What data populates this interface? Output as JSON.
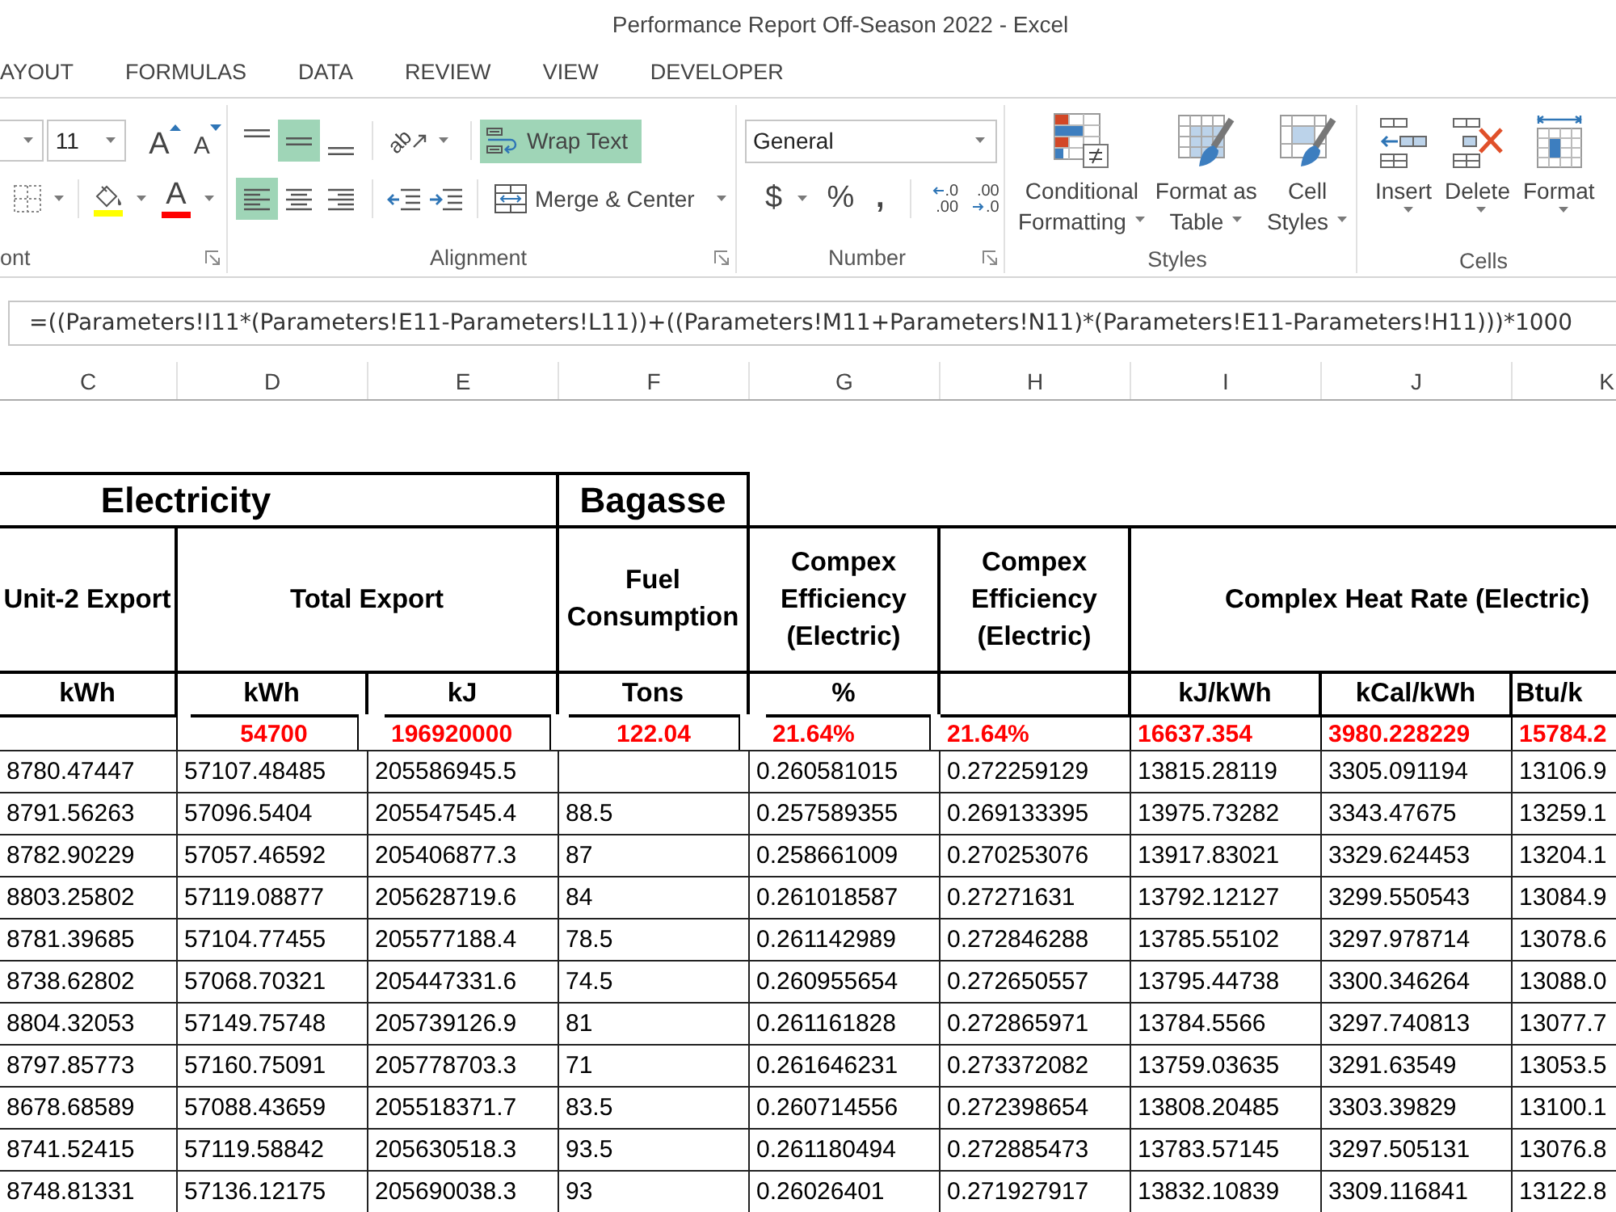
{
  "window": {
    "title": "Performance Report Off-Season 2022 - Excel"
  },
  "ribbon_tabs": [
    {
      "label": "AYOUT",
      "selected": false
    },
    {
      "label": "FORMULAS",
      "selected": false
    },
    {
      "label": "DATA",
      "selected": false
    },
    {
      "label": "REVIEW",
      "selected": false
    },
    {
      "label": "VIEW",
      "selected": false
    },
    {
      "label": "DEVELOPER",
      "selected": false
    }
  ],
  "font_group": {
    "label": "ont",
    "font_size": "11",
    "grow_glyph": "A",
    "shrink_glyph": "A",
    "color_glyph": "A"
  },
  "alignment_group": {
    "label": "Alignment",
    "vertical_align": [
      {
        "kind": "top",
        "on": false
      },
      {
        "kind": "middle",
        "on": true
      },
      {
        "kind": "bottom",
        "on": false
      }
    ],
    "orientation_glyph": "ab",
    "wrap_text": {
      "label": "Wrap Text",
      "on": true
    },
    "horizontal_align": [
      {
        "kind": "left",
        "on": true
      },
      {
        "kind": "center",
        "on": false
      },
      {
        "kind": "right",
        "on": false
      }
    ],
    "merge": {
      "label": "Merge & Center"
    }
  },
  "number_group": {
    "label": "Number",
    "format": "General",
    "currency_glyph": "$",
    "percent_glyph": "%",
    "comma_glyph": ",",
    "decimal_buttons": [
      {
        "kind": "increase",
        "top": ".0",
        "bottom": ".00"
      },
      {
        "kind": "decrease",
        "top": ".00",
        "bottom": ".0"
      }
    ]
  },
  "styles_group": {
    "label": "Styles",
    "buttons": [
      {
        "kind": "conditional",
        "lines": [
          "Conditional",
          "Formatting"
        ]
      },
      {
        "kind": "table",
        "lines": [
          "Format as",
          "Table"
        ]
      },
      {
        "kind": "cell",
        "lines": [
          "Cell",
          "Styles"
        ]
      }
    ]
  },
  "cells_group": {
    "label": "Cells",
    "buttons": [
      {
        "kind": "insert",
        "label": "Insert"
      },
      {
        "kind": "delete",
        "label": "Delete"
      },
      {
        "kind": "format",
        "label": "Format"
      }
    ]
  },
  "formula_bar": {
    "formula": "=((Parameters!I11*(Parameters!E11-Parameters!L11))+((Parameters!M11+Parameters!N11)*(Parameters!E11-Parameters!H11)))*1000"
  },
  "sheet": {
    "column_letters": [
      "C",
      "D",
      "E",
      "F",
      "G",
      "H",
      "I",
      "J",
      "K"
    ],
    "group_headers": [
      "Electricity",
      "Bagasse"
    ],
    "headers": [
      "Unit-2 Export",
      "Total Export",
      "Fuel Consumption",
      "Compex Efficiency (Electric)",
      "Compex Efficiency (Electric)",
      "Complex Heat Rate (Electric)"
    ],
    "units": {
      "unit2_kwh": "kWh",
      "total_kwh": "kWh",
      "total_kj": "kJ",
      "fuel_tons": "Tons",
      "eff_g": "%",
      "rate_kj": "kJ/kWh",
      "rate_kcal": "kCal/kWh",
      "rate_btu": "Btu/k"
    },
    "summary": {
      "total_kwh": "54700",
      "total_kj": "196920000",
      "fuel_tons": "122.04",
      "eff_g": "21.64%",
      "eff_h": "21.64%",
      "rate_kj": "16637.354",
      "rate_kcal": "3980.228229",
      "rate_btu": "15784.2"
    },
    "rows": [
      {
        "unit2_kwh": "8780.47447",
        "total_kwh": "57107.48485",
        "total_kj": "205586945.5",
        "eff_g": "0.260581015",
        "eff_h": "0.272259129",
        "rate_kj": "13815.28119",
        "rate_kcal": "3305.091194",
        "rate_btu": "13106.9"
      },
      {
        "unit2_kwh": "8791.56263",
        "total_kwh": "57096.5404",
        "total_kj": "205547545.4",
        "fuel_tons": "88.5",
        "eff_g": "0.257589355",
        "eff_h": "0.269133395",
        "rate_kj": "13975.73282",
        "rate_kcal": "3343.47675",
        "rate_btu": "13259.1"
      },
      {
        "unit2_kwh": "8782.90229",
        "total_kwh": "57057.46592",
        "total_kj": "205406877.3",
        "fuel_tons": "87",
        "eff_g": "0.258661009",
        "eff_h": "0.270253076",
        "rate_kj": "13917.83021",
        "rate_kcal": "3329.624453",
        "rate_btu": "13204.1"
      },
      {
        "unit2_kwh": "8803.25802",
        "total_kwh": "57119.08877",
        "total_kj": "205628719.6",
        "fuel_tons": "84",
        "eff_g": "0.261018587",
        "eff_h": "0.27271631",
        "rate_kj": "13792.12127",
        "rate_kcal": "3299.550543",
        "rate_btu": "13084.9"
      },
      {
        "unit2_kwh": "8781.39685",
        "total_kwh": "57104.77455",
        "total_kj": "205577188.4",
        "fuel_tons": "78.5",
        "eff_g": "0.261142989",
        "eff_h": "0.272846288",
        "rate_kj": "13785.55102",
        "rate_kcal": "3297.978714",
        "rate_btu": "13078.6"
      },
      {
        "unit2_kwh": "8738.62802",
        "total_kwh": "57068.70321",
        "total_kj": "205447331.6",
        "fuel_tons": "74.5",
        "eff_g": "0.260955654",
        "eff_h": "0.272650557",
        "rate_kj": "13795.44738",
        "rate_kcal": "3300.346264",
        "rate_btu": "13088.0"
      },
      {
        "unit2_kwh": "8804.32053",
        "total_kwh": "57149.75748",
        "total_kj": "205739126.9",
        "fuel_tons": "81",
        "eff_g": "0.261161828",
        "eff_h": "0.272865971",
        "rate_kj": "13784.5566",
        "rate_kcal": "3297.740813",
        "rate_btu": "13077.7"
      },
      {
        "unit2_kwh": "8797.85773",
        "total_kwh": "57160.75091",
        "total_kj": "205778703.3",
        "fuel_tons": "71",
        "eff_g": "0.261646231",
        "eff_h": "0.273372082",
        "rate_kj": "13759.03635",
        "rate_kcal": "3291.63549",
        "rate_btu": "13053.5"
      },
      {
        "unit2_kwh": "8678.68589",
        "total_kwh": "57088.43659",
        "total_kj": "205518371.7",
        "fuel_tons": "83.5",
        "eff_g": "0.260714556",
        "eff_h": "0.272398654",
        "rate_kj": "13808.20485",
        "rate_kcal": "3303.39829",
        "rate_btu": "13100.1"
      },
      {
        "unit2_kwh": "8741.52415",
        "total_kwh": "57119.58842",
        "total_kj": "205630518.3",
        "fuel_tons": "93.5",
        "eff_g": "0.261180494",
        "eff_h": "0.272885473",
        "rate_kj": "13783.57145",
        "rate_kcal": "3297.505131",
        "rate_btu": "13076.8"
      },
      {
        "unit2_kwh": "8748.81331",
        "total_kwh": "57136.12175",
        "total_kj": "205690038.3",
        "fuel_tons": "93",
        "eff_g": "0.26026401",
        "eff_h": "0.271927917",
        "rate_kj": "13832.10839",
        "rate_kcal": "3309.116841",
        "rate_btu": "13122.8"
      }
    ]
  }
}
